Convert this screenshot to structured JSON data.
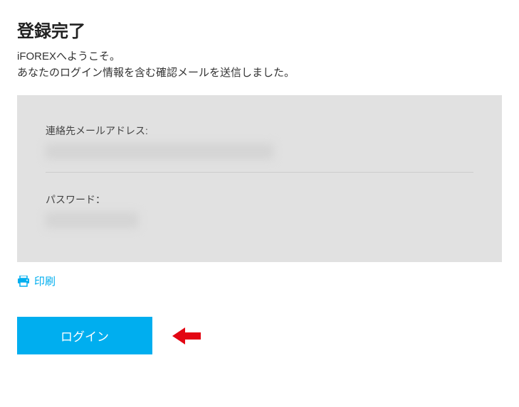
{
  "header": {
    "title": "登録完了",
    "welcome": "iFOREXへようこそ。",
    "confirmation": "あなたのログイン情報を含む確認メールを送信しました。"
  },
  "info": {
    "email_label": "連絡先メールアドレス:",
    "password_label": "パスワード："
  },
  "actions": {
    "print_label": "印刷",
    "login_label": "ログイン"
  },
  "colors": {
    "accent": "#00aeef",
    "panel": "#e1e1e1",
    "arrow": "#e30613"
  }
}
